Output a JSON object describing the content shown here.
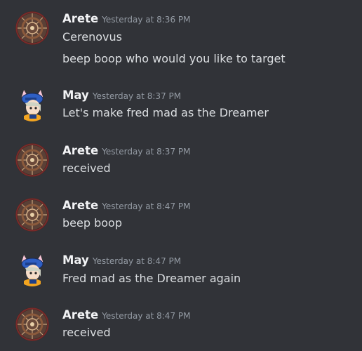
{
  "messages": [
    {
      "author": "Arete",
      "avatar": "kaleidoscope-avatar",
      "timestamp": "Yesterday at 8:36 PM",
      "lines": [
        "Cerenovus",
        "beep boop who would you like to target"
      ]
    },
    {
      "author": "May",
      "avatar": "anime-cat-girl-avatar",
      "timestamp": "Yesterday at 8:37 PM",
      "lines": [
        "Let's make fred mad as the Dreamer"
      ]
    },
    {
      "author": "Arete",
      "avatar": "kaleidoscope-avatar",
      "timestamp": "Yesterday at 8:37 PM",
      "lines": [
        "received"
      ]
    },
    {
      "author": "Arete",
      "avatar": "kaleidoscope-avatar",
      "timestamp": "Yesterday at 8:47 PM",
      "lines": [
        "beep boop"
      ]
    },
    {
      "author": "May",
      "avatar": "anime-cat-girl-avatar",
      "timestamp": "Yesterday at 8:47 PM",
      "lines": [
        "Fred mad as the Dreamer again"
      ]
    },
    {
      "author": "Arete",
      "avatar": "kaleidoscope-avatar",
      "timestamp": "Yesterday at 8:47 PM",
      "lines": [
        "received"
      ]
    }
  ],
  "colors": {
    "background": "#313338",
    "author": "#f2f3f5",
    "timestamp": "#949ba4",
    "text": "#dbdee1"
  }
}
